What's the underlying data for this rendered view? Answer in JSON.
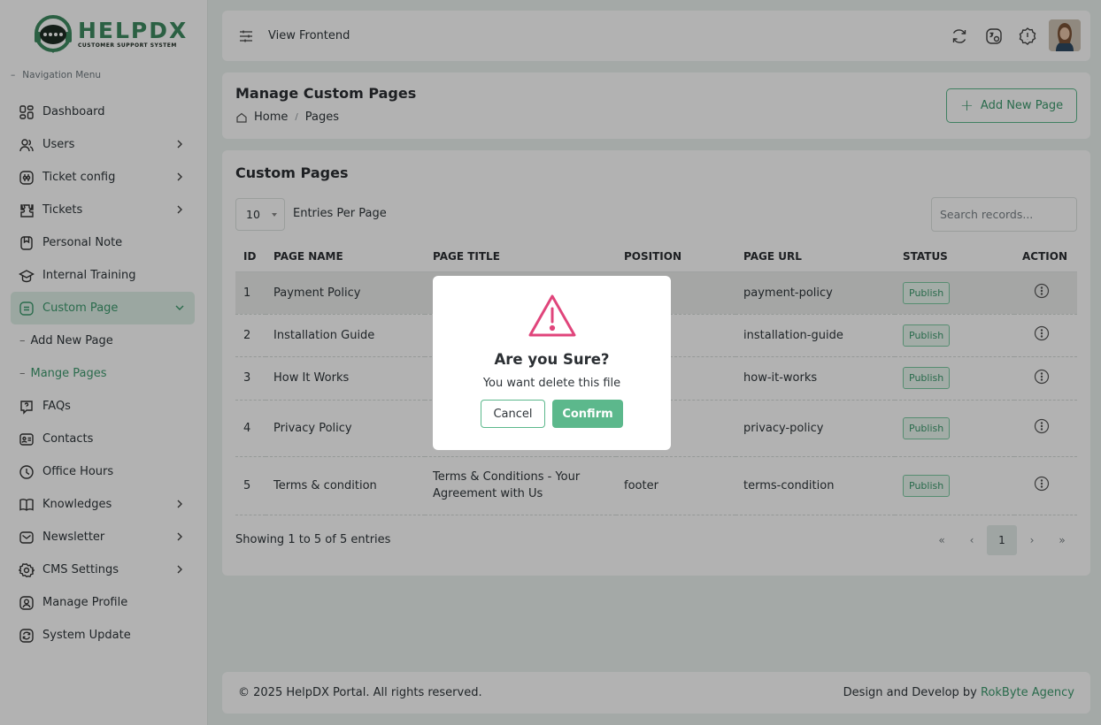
{
  "brand": {
    "title": "HELPDX",
    "subtitle": "CUSTOMER SUPPORT SYSTEM",
    "accent": "#3d9a6e"
  },
  "sidebar": {
    "header": "Navigation Menu",
    "items": [
      {
        "label": "Dashboard",
        "icon": "dashboard-icon",
        "has_children": false
      },
      {
        "label": "Users",
        "icon": "users-icon",
        "has_children": true
      },
      {
        "label": "Ticket config",
        "icon": "ticket-config-icon",
        "has_children": true
      },
      {
        "label": "Tickets",
        "icon": "tickets-icon",
        "has_children": true
      },
      {
        "label": "Personal Note",
        "icon": "note-icon",
        "has_children": false
      },
      {
        "label": "Internal Training",
        "icon": "training-icon",
        "has_children": false
      },
      {
        "label": "Custom Page",
        "icon": "custom-page-icon",
        "has_children": true,
        "active": true,
        "children": [
          {
            "label": "Add New Page"
          },
          {
            "label": "Mange Pages",
            "active": true
          }
        ]
      },
      {
        "label": "FAQs",
        "icon": "faq-icon",
        "has_children": false
      },
      {
        "label": "Contacts",
        "icon": "contacts-icon",
        "has_children": false
      },
      {
        "label": "Office Hours",
        "icon": "clock-icon",
        "has_children": false
      },
      {
        "label": "Knowledges",
        "icon": "knowledge-icon",
        "has_children": true
      },
      {
        "label": "Newsletter",
        "icon": "newsletter-icon",
        "has_children": true
      },
      {
        "label": "CMS Settings",
        "icon": "gear-icon",
        "has_children": true
      },
      {
        "label": "Manage Profile",
        "icon": "profile-icon",
        "has_children": false
      },
      {
        "label": "System Update",
        "icon": "update-icon",
        "has_children": false
      }
    ]
  },
  "topbar": {
    "view_frontend": "View Frontend"
  },
  "page_header": {
    "title": "Manage Custom Pages",
    "breadcrumb": [
      "Home",
      "Pages"
    ],
    "add_button": "Add New Page"
  },
  "card": {
    "title": "Custom Pages",
    "per_page": "10",
    "per_page_label": "Entries Per Page",
    "search_placeholder": "Search records...",
    "columns": [
      "ID",
      "PAGE NAME",
      "PAGE TITLE",
      "POSITION",
      "PAGE URL",
      "STATUS",
      "ACTION"
    ],
    "rows": [
      {
        "id": "1",
        "name": "Payment Policy",
        "title": "",
        "position": "",
        "url": "payment-policy",
        "status": "Publish"
      },
      {
        "id": "2",
        "name": "Installation Guide",
        "title": "",
        "position": "",
        "url": "installation-guide",
        "status": "Publish"
      },
      {
        "id": "3",
        "name": "How It Works",
        "title": "",
        "position": "",
        "url": "how-it-works",
        "status": "Publish"
      },
      {
        "id": "4",
        "name": "Privacy Policy",
        "title": "",
        "position": "",
        "url": "privacy-policy",
        "status": "Publish"
      },
      {
        "id": "5",
        "name": "Terms & condition",
        "title": "Terms & Conditions - Your Agreement with Us",
        "position": "footer",
        "url": "terms-condition",
        "status": "Publish"
      }
    ],
    "showing": "Showing 1 to 5 of 5 entries",
    "pager": {
      "first": "«",
      "prev": "‹",
      "current": "1",
      "next": "›",
      "last": "»"
    }
  },
  "footer": {
    "copyright": "© 2025 HelpDX Portal. All rights reserved.",
    "credit_prefix": "Design and Develop by ",
    "credit_link": "RokByte Agency"
  },
  "modal": {
    "title": "Are you Sure?",
    "message": "You want delete this file",
    "cancel": "Cancel",
    "confirm": "Confirm",
    "warning_color": "#e0457b"
  }
}
